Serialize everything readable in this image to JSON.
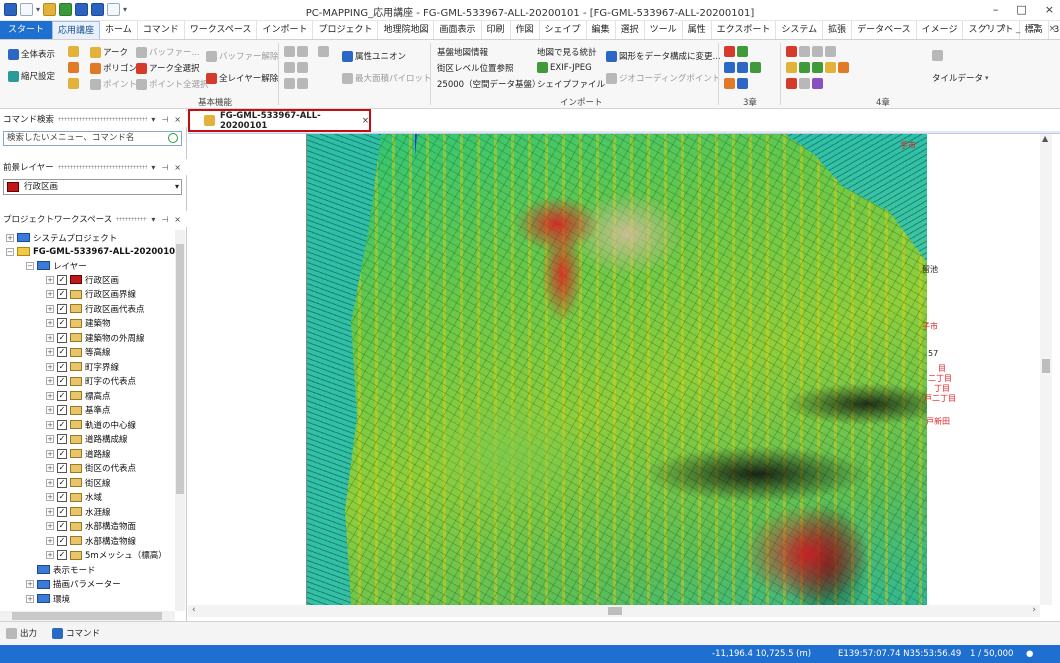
{
  "window": {
    "title": "PC-MAPPING_応用講座 - FG-GML-533967-ALL-20200101 - [FG-GML-533967-ALL-20200101]",
    "buttons": [
      "–",
      "□",
      "×"
    ]
  },
  "ribbon_tabs": [
    "スタート",
    "応用講座",
    "ホーム",
    "コマンド",
    "ワークスペース",
    "インポート",
    "プロジェクト",
    "地理院地図",
    "画面表示",
    "印刷",
    "作図",
    "シェイプ",
    "編集",
    "選択",
    "ツール",
    "属性",
    "エクスポート",
    "システム",
    "拡張",
    "データベース",
    "イメージ",
    "スクリプト",
    "標高",
    "3D",
    "GL"
  ],
  "ribbon_right": [
    "^",
    "?",
    "_",
    "❐",
    "×"
  ],
  "ribbon": {
    "kihon": {
      "zentai": "全体表示",
      "shukusho": "縮尺設定",
      "arc": "アーク",
      "polygon": "ポリゴン",
      "point": "ポイント",
      "buffer": "バッファー...",
      "arc_all": "アーク全選択",
      "point_all": "ポイント全選択",
      "buffer_clear": "バッファー解除",
      "layer_clear": "全レイヤー解除",
      "label": "基本機能"
    },
    "mid": {
      "zokusei_union": "属性ユニオン",
      "max_area": "最大面積パイロット"
    },
    "import": {
      "kiban": "基盤地図情報",
      "gaiku": "街区レベル位置参照",
      "k25000": "25000（空間データ基盤）",
      "chizu": "地図で見る統計",
      "exif": "EXIF-JPEG",
      "shape": "シェイプファイル",
      "zukei": "図形をデータ構成に変更...",
      "geocode": "ジオコーディングポイント",
      "label": "インポート"
    },
    "g3": {
      "label": "3章"
    },
    "g4": {
      "label": "4章"
    },
    "tile": {
      "label": "タイルデータ"
    }
  },
  "left": {
    "command_search": {
      "header": "コマンド検索",
      "placeholder": "検索したいメニュー、コマンド名"
    },
    "foreground": {
      "header": "前景レイヤー",
      "value": "行政区画"
    },
    "workspace": {
      "header": "プロジェクトワークスペース"
    },
    "tree": {
      "system": "システムプロジェクト",
      "project": "FG-GML-533967-ALL-20200101",
      "layers": "レイヤー",
      "items": [
        "行政区画",
        "行政区画界線",
        "行政区画代表点",
        "建築物",
        "建築物の外周線",
        "等高線",
        "町字界線",
        "町字の代表点",
        "標高点",
        "基準点",
        "軌道の中心線",
        "道路構成線",
        "道路線",
        "街区の代表点",
        "街区線",
        "水域",
        "水涯線",
        "水部構造物面",
        "水部構造物線",
        "5mメッシュ（標高）"
      ],
      "display_mode": "表示モード",
      "draw_params": "描画パラメーター",
      "env": "環境"
    }
  },
  "document": {
    "tab": "FG-GML-533967-ALL-20200101",
    "close": "×"
  },
  "map": {
    "labels": [
      {
        "t": "手市",
        "c": "red"
      },
      {
        "t": "留池",
        "c": "black"
      },
      {
        "t": "子市",
        "c": "red"
      },
      {
        "t": "57",
        "c": "black"
      },
      {
        "t": "目",
        "c": "red"
      },
      {
        "t": "二丁目",
        "c": "red"
      },
      {
        "t": "丁目",
        "c": "red"
      },
      {
        "t": "戸二丁目",
        "c": "red"
      },
      {
        "t": "戸新田",
        "c": "red"
      }
    ]
  },
  "bottom": {
    "output": "出力",
    "command": "コマンド"
  },
  "status": {
    "coords": "-11,196.4  10,725.5 (m)",
    "latlon": "E139:57:07.74 N35:53:56.49",
    "scale": "1 / 50,000"
  }
}
